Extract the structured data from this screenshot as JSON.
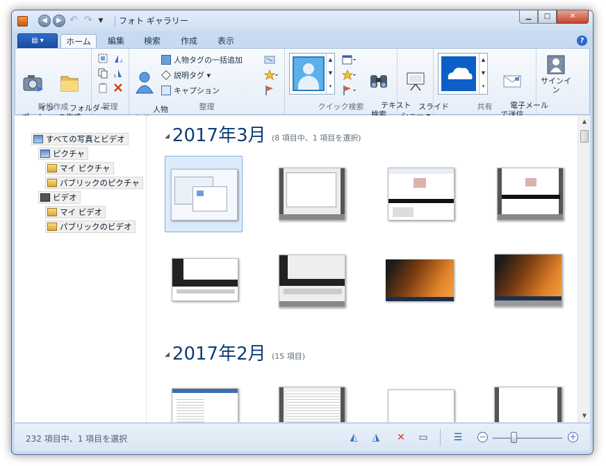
{
  "window": {
    "title": "フォト ギャラリー"
  },
  "tabs": {
    "home": "ホーム",
    "edit": "編集",
    "find": "検索",
    "create": "作成",
    "view": "表示",
    "help": "?"
  },
  "ribbon": {
    "new": {
      "import": "イン\nポート",
      "folder": "フォルダー\nの作成",
      "label": "新規作成"
    },
    "manage": {
      "label": "管理"
    },
    "organize": {
      "people_tag": "人物\nタグ ▾",
      "batch_people": "人物タグの一括追加",
      "desc_tag": "説明タグ ▾",
      "caption": "キャプション",
      "label": "整理"
    },
    "quickfind": {
      "text_search": "テキスト\n検索",
      "label": "クイック検索"
    },
    "slideshow": "スライド\nショー ▾",
    "share": {
      "email": "電子メール\nで送信",
      "label": "共有"
    },
    "signin": "サインイン"
  },
  "nav": {
    "all": "すべての写真とビデオ",
    "pictures": "ピクチャ",
    "my_pictures": "マイ ピクチャ",
    "public_pictures": "パブリックのピクチャ",
    "videos": "ビデオ",
    "my_videos": "マイ ビデオ",
    "public_videos": "パブリックのビデオ"
  },
  "groups": [
    {
      "title": "2017年3月",
      "sub": "(8 項目中、1 項目を選択)"
    },
    {
      "title": "2017年2月",
      "sub": "(15 項目)"
    }
  ],
  "status": {
    "text": "232 項目中、1 項目を選択",
    "zoom_percent": 30
  },
  "colors": {
    "accent": "#1a4fa2",
    "heading": "#0e3d76",
    "selection": "#dcebfc"
  }
}
